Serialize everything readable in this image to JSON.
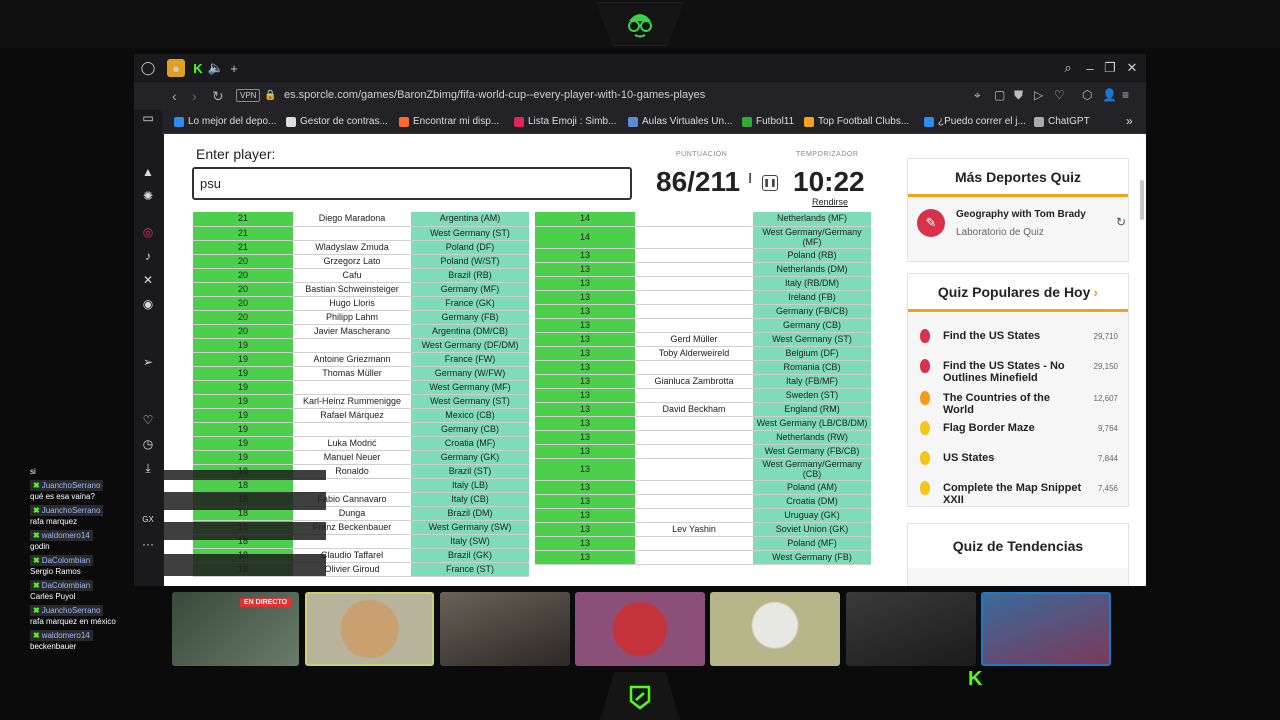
{
  "browser": {
    "url": "es.sporcle.com/games/BaronZbimg/fifa-world-cup--every-player-with-10-games-playes",
    "vpn": "VPN",
    "bookmarks": [
      "Lo mejor del depo...",
      "Gestor de contras...",
      "Encontrar mi disp...",
      "Lista Emoji : Simb...",
      "Aulas Virtuales Un...",
      "Futbol11",
      "Top Football Clubs...",
      "¿Puedo correr el j...",
      "ChatGPT"
    ],
    "colors": {
      "accent": "#53fc18",
      "green_cell": "#4cd04c",
      "teal_cell": "#7fdcb8",
      "orange": "#f3a21a"
    }
  },
  "quiz": {
    "enter_label": "Enter player:",
    "input_value": "psu",
    "score_label": "PUNTUACIÓN",
    "timer_label": "TEMPORIZADOR",
    "score": "86/211",
    "timer": "10:22",
    "give_up": "Rendirse",
    "left_rows": [
      [
        "21",
        "Diego Maradona",
        "Argentina (AM)"
      ],
      [
        "21",
        "",
        "West Germany (ST)"
      ],
      [
        "21",
        "Wladyslaw Zmuda",
        "Poland (DF)"
      ],
      [
        "20",
        "Grzegorz Lato",
        "Poland (W/ST)"
      ],
      [
        "20",
        "Cafu",
        "Brazil (RB)"
      ],
      [
        "20",
        "Bastian Schweinsteiger",
        "Germany (MF)"
      ],
      [
        "20",
        "Hugo Lloris",
        "France (GK)"
      ],
      [
        "20",
        "Philipp Lahm",
        "Germany (FB)"
      ],
      [
        "20",
        "Javier Mascherano",
        "Argentina (DM/CB)"
      ],
      [
        "19",
        "",
        "West Germany (DF/DM)"
      ],
      [
        "19",
        "Antoine Griezmann",
        "France (FW)"
      ],
      [
        "19",
        "Thomas Müller",
        "Germany (W/FW)"
      ],
      [
        "19",
        "",
        "West Germany (MF)"
      ],
      [
        "19",
        "Karl-Heinz Rummenigge",
        "West Germany (ST)"
      ],
      [
        "19",
        "Rafael Márquez",
        "Mexico (CB)"
      ],
      [
        "19",
        "",
        "Germany (CB)"
      ],
      [
        "19",
        "Luka Modrić",
        "Croatia (MF)"
      ],
      [
        "19",
        "Manuel Neuer",
        "Germany (GK)"
      ],
      [
        "18",
        "Ronaldo",
        "Brazil (ST)"
      ],
      [
        "18",
        "",
        "Italy (LB)"
      ],
      [
        "18",
        "Fabio Cannavaro",
        "Italy (CB)"
      ],
      [
        "18",
        "Dunga",
        "Brazil (DM)"
      ],
      [
        "18",
        "Franz Beckenbauer",
        "West Germany (SW)"
      ],
      [
        "18",
        "",
        "Italy (SW)"
      ],
      [
        "18",
        "Claudio Taffarel",
        "Brazil (GK)"
      ],
      [
        "18",
        "Olivier Giroud",
        "France (ST)"
      ]
    ],
    "right_rows": [
      [
        "14",
        "",
        "Netherlands (MF)"
      ],
      [
        "14",
        "",
        "West Germany/Germany (MF)"
      ],
      [
        "13",
        "",
        "Poland (RB)"
      ],
      [
        "13",
        "",
        "Netherlands (DM)"
      ],
      [
        "13",
        "",
        "Italy (RB/DM)"
      ],
      [
        "13",
        "",
        "Ireland (FB)"
      ],
      [
        "13",
        "",
        "Germany (FB/CB)"
      ],
      [
        "13",
        "",
        "Germany (CB)"
      ],
      [
        "13",
        "Gerd Müller",
        "West Germany (ST)"
      ],
      [
        "13",
        "Toby Alderweireld",
        "Belgium (DF)"
      ],
      [
        "13",
        "",
        "Romania (CB)"
      ],
      [
        "13",
        "Gianluca Zambrotta",
        "Italy (FB/MF)"
      ],
      [
        "13",
        "",
        "Sweden (ST)"
      ],
      [
        "13",
        "David Beckham",
        "England (RM)"
      ],
      [
        "13",
        "",
        "West Germany (LB/CB/DM)"
      ],
      [
        "13",
        "",
        "Netherlands (RW)"
      ],
      [
        "13",
        "",
        "West Germany (FB/CB)"
      ],
      [
        "13",
        "",
        "West Germany/Germany (CB)"
      ],
      [
        "13",
        "",
        "Poland (AM)"
      ],
      [
        "13",
        "",
        "Croatia (DM)"
      ],
      [
        "13",
        "",
        "Uruguay (GK)"
      ],
      [
        "13",
        "Lev Yashin",
        "Soviet Union (GK)"
      ],
      [
        "13",
        "",
        "Poland (MF)"
      ],
      [
        "13",
        "",
        "West Germany (FB)"
      ]
    ]
  },
  "side": {
    "more_title": "Más Deportes Quiz",
    "more_item_title": "Geography with Tom Brady",
    "more_item_sub": "Laboratorio de Quiz",
    "popular_title": "Quiz Populares de Hoy",
    "popular": [
      {
        "title": "Find the US States",
        "count": "29,710",
        "color": "#d8324a"
      },
      {
        "title": "Find the US States - No Outlines Minefield",
        "count": "29,150",
        "color": "#d8324a"
      },
      {
        "title": "The Countries of the World",
        "count": "12,607",
        "color": "#f39a1a"
      },
      {
        "title": "Flag Border Maze",
        "count": "9,764",
        "color": "#f5c518"
      },
      {
        "title": "US States",
        "count": "7,844",
        "color": "#f5c518"
      },
      {
        "title": "Complete the Map Snippet XXII",
        "count": "7,456",
        "color": "#f5c518"
      }
    ],
    "trending_title": "Quiz de Tendencias"
  },
  "stream": {
    "live_badge": "EN DIRECTO",
    "chat": [
      {
        "user": "",
        "msg": "si"
      },
      {
        "user": "JuanchoSerrano",
        "msg": "qué es esa vaina?"
      },
      {
        "user": "JuanchoSerrano",
        "msg": "rafa marquez"
      },
      {
        "user": "waldomero14",
        "msg": "godin"
      },
      {
        "user": "DaColombian",
        "msg": "Sergio Ramos"
      },
      {
        "user": "DaColombian",
        "msg": "Carles Puyol"
      },
      {
        "user": "JuanchoSerrano",
        "msg": "rafa marquez en méxico"
      },
      {
        "user": "waldomero14",
        "msg": "beckenbauer"
      }
    ]
  }
}
